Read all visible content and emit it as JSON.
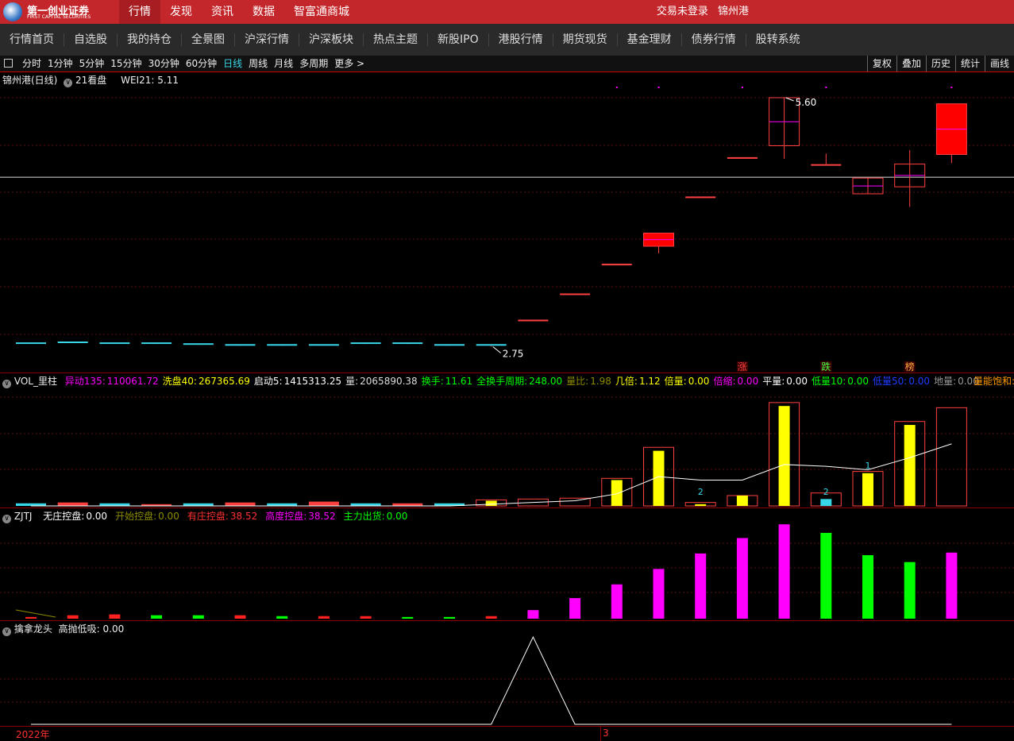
{
  "topbar": {
    "logo_cn": "第一创业证券",
    "logo_en": "FIRST CAPITAL SECURITIES",
    "nav": [
      "行情",
      "发现",
      "资讯",
      "数据",
      "智富通商城"
    ],
    "active_index": 0,
    "login_status": "交易未登录",
    "stock_name": "锦州港"
  },
  "subnav": [
    "行情首页",
    "自选股",
    "我的持仓",
    "全景图",
    "沪深行情",
    "沪深板块",
    "热点主题",
    "新股IPO",
    "港股行情",
    "期货现货",
    "基金理财",
    "债券行情",
    "股转系统"
  ],
  "periods": {
    "items": [
      "分时",
      "1分钟",
      "5分钟",
      "15分钟",
      "30分钟",
      "60分钟",
      "日线",
      "周线",
      "月线",
      "多周期",
      "更多 >"
    ],
    "active_index": 6,
    "tools": [
      "复权",
      "叠加",
      "历史",
      "统计",
      "画线"
    ]
  },
  "main_panel": {
    "title": "锦州港(日线)",
    "indicator": "21看盘",
    "wei_label": "WEI21:",
    "wei_value": "5.11",
    "high_label": "5.60",
    "low_label": "2.75",
    "markers": [
      "涨",
      "跌",
      "榜"
    ],
    "colors": {
      "up": "#ff0000",
      "flat": "#38d7e7",
      "outline": "#ff4040",
      "mid": "#ff00ff"
    }
  },
  "vol_panel": {
    "title": "VOL_里柱",
    "stats": [
      {
        "label": "异动135:",
        "value": "110061.72",
        "color": "#ff00ff"
      },
      {
        "label": "洗盘40:",
        "value": "267365.69",
        "color": "#ffff00"
      },
      {
        "label": "启动5:",
        "value": "1415313.25",
        "color": "#ffffff"
      },
      {
        "label": "量:",
        "value": "2065890.38",
        "color": "#dddddd"
      },
      {
        "label": "换手:",
        "value": "11.61",
        "color": "#00ff00"
      },
      {
        "label": "全换手周期:",
        "value": "248.00",
        "color": "#00ff00"
      },
      {
        "label": "量比:",
        "value": "1.98",
        "color": "#8b8b00"
      },
      {
        "label": "几倍:",
        "value": "1.12",
        "color": "#ffff00"
      },
      {
        "label": "倍量:",
        "value": "0.00",
        "color": "#ffff00"
      },
      {
        "label": "倍缩:",
        "value": "0.00",
        "color": "#ff00ff"
      },
      {
        "label": "平量:",
        "value": "0.00",
        "color": "#ffffff"
      },
      {
        "label": "低量10:",
        "value": "0.00",
        "color": "#00ff00"
      },
      {
        "label": "低量50:",
        "value": "0.00",
        "color": "#1e3cff"
      },
      {
        "label": "地量:",
        "value": "0.00",
        "color": "#999999"
      }
    ],
    "extra": "量能饱和:",
    "bar_labels": [
      "2",
      "2",
      "1"
    ]
  },
  "zjtj_panel": {
    "title": "ZJTJ",
    "stats": [
      {
        "label": "无庄控盘:",
        "value": "0.00",
        "color": "#ffffff"
      },
      {
        "label": "开始控盘:",
        "value": "0.00",
        "color": "#8b8b00"
      },
      {
        "label": "有庄控盘:",
        "value": "38.52",
        "color": "#ff3030"
      },
      {
        "label": "高度控盘:",
        "value": "38.52",
        "color": "#ff00ff"
      },
      {
        "label": "主力出货:",
        "value": "0.00",
        "color": "#00ff00"
      }
    ]
  },
  "bottom_panel": {
    "title": "擒拿龙头",
    "stat_label": "高抛低吸:",
    "stat_value": "0.00",
    "x_labels": [
      "2022年",
      "3"
    ]
  },
  "chart_data": [
    {
      "type": "candlestick",
      "title": "锦州港(日线)",
      "series": [
        {
          "open": 2.79,
          "close": 2.79,
          "high": 2.79,
          "low": 2.79
        },
        {
          "open": 2.8,
          "close": 2.79,
          "high": 2.8,
          "low": 2.79
        },
        {
          "open": 2.79,
          "close": 2.79,
          "high": 2.79,
          "low": 2.79
        },
        {
          "open": 2.79,
          "close": 2.78,
          "high": 2.79,
          "low": 2.78
        },
        {
          "open": 2.78,
          "close": 2.77,
          "high": 2.78,
          "low": 2.77
        },
        {
          "open": 2.77,
          "close": 2.76,
          "high": 2.77,
          "low": 2.76
        },
        {
          "open": 2.77,
          "close": 2.76,
          "high": 2.77,
          "low": 2.76
        },
        {
          "open": 2.77,
          "close": 2.76,
          "high": 2.77,
          "low": 2.76
        },
        {
          "open": 2.79,
          "close": 2.78,
          "high": 2.79,
          "low": 2.78
        },
        {
          "open": 2.79,
          "close": 2.78,
          "high": 2.79,
          "low": 2.78
        },
        {
          "open": 2.77,
          "close": 2.76,
          "high": 2.77,
          "low": 2.76
        },
        {
          "open": 2.77,
          "close": 2.77,
          "high": 2.77,
          "low": 2.75
        },
        {
          "open": 3.05,
          "close": 3.05,
          "high": 3.05,
          "low": 3.05
        },
        {
          "open": 3.35,
          "close": 3.35,
          "high": 3.35,
          "low": 3.35
        },
        {
          "open": 3.69,
          "close": 3.69,
          "high": 3.69,
          "low": 3.69
        },
        {
          "open": 3.9,
          "close": 4.05,
          "high": 4.05,
          "low": 3.82
        },
        {
          "open": 4.46,
          "close": 4.46,
          "high": 4.46,
          "low": 4.46
        },
        {
          "open": 4.91,
          "close": 4.91,
          "high": 4.91,
          "low": 4.91
        },
        {
          "open": 5.6,
          "close": 5.05,
          "high": 5.6,
          "low": 4.9
        },
        {
          "open": 4.83,
          "close": 4.83,
          "high": 4.96,
          "low": 4.83
        },
        {
          "open": 4.5,
          "close": 4.68,
          "high": 4.68,
          "low": 4.5
        },
        {
          "open": 4.58,
          "close": 4.84,
          "high": 5.0,
          "low": 4.35
        },
        {
          "open": 4.95,
          "close": 5.53,
          "high": 5.53,
          "low": 4.85
        }
      ],
      "reference_line": 4.69,
      "ylim": [
        2.7,
        5.7
      ]
    },
    {
      "type": "bar",
      "title": "VOL_里柱",
      "values": [
        1.5,
        2,
        1.5,
        1,
        1.5,
        2,
        1.5,
        2.5,
        1.5,
        1.5,
        1.5,
        3.5,
        4,
        4.5,
        16,
        34,
        2,
        6,
        60,
        7.5,
        20,
        49,
        57
      ],
      "inner_values": [
        0,
        0,
        0,
        0,
        0,
        0,
        0,
        0,
        0,
        0,
        0,
        3,
        0,
        0,
        15,
        32,
        1,
        6,
        58,
        4,
        19,
        47,
        0
      ],
      "ma_values": [
        0,
        0,
        0,
        0,
        0,
        0,
        0,
        0,
        0,
        0,
        0,
        1,
        2,
        3,
        7,
        17,
        15,
        15,
        24,
        23,
        21,
        28,
        36
      ],
      "ylim": [
        0,
        65
      ]
    },
    {
      "type": "bar",
      "title": "ZJTJ",
      "values": [
        1,
        2,
        2.5,
        2,
        2,
        2,
        1.5,
        1.5,
        1.5,
        1,
        1,
        1.5,
        5,
        12,
        20,
        29,
        38,
        47,
        55,
        50,
        37,
        33,
        38.52
      ],
      "colors": [
        "#ff2020",
        "#ff2020",
        "#ff2020",
        "#00ff00",
        "#00ff00",
        "#ff2020",
        "#00ff00",
        "#ff2020",
        "#ff2020",
        "#00ff00",
        "#00ff00",
        "#ff2020",
        "#ff00ff",
        "#ff00ff",
        "#ff00ff",
        "#ff00ff",
        "#ff00ff",
        "#ff00ff",
        "#ff00ff",
        "#00ff00",
        "#00ff00",
        "#00ff00",
        "#ff00ff"
      ],
      "ylim": [
        0,
        56
      ]
    },
    {
      "type": "line",
      "title": "擒拿龙头",
      "values": [
        0,
        0,
        0,
        0,
        0,
        0,
        0,
        0,
        0,
        0,
        0,
        0,
        100,
        0,
        0,
        0,
        0,
        0,
        0,
        0,
        0,
        0,
        0
      ],
      "ylim": [
        0,
        100
      ]
    }
  ]
}
